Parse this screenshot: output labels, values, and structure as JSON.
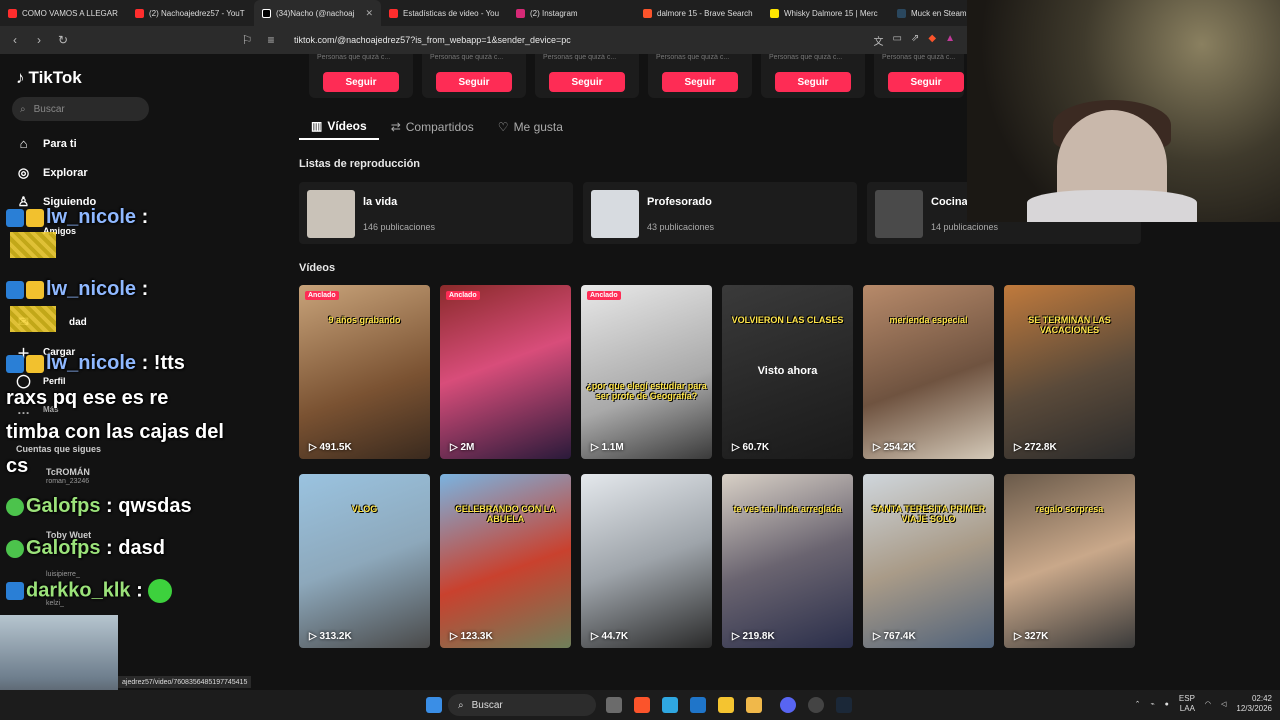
{
  "browser": {
    "tabs": [
      {
        "title": "COMO VAMOS A LLEGAR",
        "color": "#ff2d2d"
      },
      {
        "title": "(2) Nachoajedrez57 - YouT",
        "color": "#ff2d2d"
      },
      {
        "title": "(34)Nacho (@nachoaj",
        "color": "#111111",
        "active": true
      },
      {
        "title": "Estadísticas de video - You",
        "color": "#ff2d2d"
      },
      {
        "title": "(2) Instagram",
        "color": "#d62976"
      },
      {
        "title": "dalmore 15 - Brave Search",
        "color": "#fb542b"
      },
      {
        "title": "Whisky Dalmore 15 | Merc",
        "color": "#ffe600"
      },
      {
        "title": "Muck en Steam",
        "color": "#2a475e"
      }
    ],
    "url": "tiktok.com/@nachoajedrez57?is_from_webapp=1&sender_device=pc",
    "status_url": "ajedrez57/video/7608356485197745415"
  },
  "sidebar": {
    "logo": "TikTok",
    "search_placeholder": "Buscar",
    "items": [
      {
        "label": "Para ti",
        "icon": "home-icon"
      },
      {
        "label": "Explorar",
        "icon": "compass-icon"
      },
      {
        "label": "Siguiendo",
        "icon": "following-icon"
      },
      {
        "label": "Amigos",
        "icon": "friends-icon"
      },
      {
        "label": "dad",
        "icon": "direct-icon"
      },
      {
        "label": "Cargar",
        "icon": "upload-icon"
      },
      {
        "label": "Perfil",
        "icon": "profile-icon"
      },
      {
        "label": "Más",
        "icon": "more-icon"
      }
    ],
    "following_title": "Cuentas que sigues",
    "following": [
      {
        "name": "TcROMÁN",
        "handle": "roman_23246"
      },
      {
        "name": "Toby Wuet",
        "handle": "luisipierre_"
      },
      {
        "name": "kelzi",
        "handle": "kelzi_"
      }
    ]
  },
  "chat": [
    {
      "user": "lw_nicole",
      "text": ":"
    },
    {
      "user": "lw_nicole",
      "text": ":"
    },
    {
      "user": "lw_nicole",
      "text": ": !tts"
    },
    {
      "user": "",
      "text": "raxs pq ese es re"
    },
    {
      "user": "",
      "text": "timba con las cajas del"
    },
    {
      "user": "",
      "text": "cs"
    },
    {
      "user": "Galofps",
      "text": ": qwsdas"
    },
    {
      "user": "Galofps",
      "text": ": dasd"
    },
    {
      "user": "darkko_klk",
      "text": ":"
    }
  ],
  "suggestions": {
    "caption": "Personas que quizá c...",
    "button": "Seguir"
  },
  "profile_tabs": [
    {
      "label": "Vídeos",
      "icon": "grid-icon"
    },
    {
      "label": "Compartidos",
      "icon": "repost-icon"
    },
    {
      "label": "Me gusta",
      "icon": "heart-icon"
    }
  ],
  "playlists_title": "Listas de reproducción",
  "playlists": [
    {
      "name": "la vida",
      "count": "146 publicaciones",
      "color": "#c9c2b8"
    },
    {
      "name": "Profesorado",
      "count": "43 publicaciones",
      "color": "#d7dbe0"
    },
    {
      "name": "Cocina",
      "count": "14 publicaciones",
      "color": "#4a4a4a"
    }
  ],
  "videos_title": "Vídeos",
  "pinned_label": "Anclado",
  "watched_label": "Visto ahora",
  "videos": [
    {
      "views": "491.5K",
      "pinned": true,
      "overlay": "9 años grabando",
      "bg": "linear-gradient(160deg,#c8a37a,#7a5232 60%,#3a2a1e)"
    },
    {
      "views": "2M",
      "pinned": true,
      "overlay": "",
      "bg": "linear-gradient(160deg,#8a2a2a,#d84d7a 45%,#2a1a3a)"
    },
    {
      "views": "1.1M",
      "pinned": true,
      "overlay": "¿por que elegí estudiar para ser profe de Geografía?",
      "bg": "linear-gradient(160deg,#e8e8e8,#a9a9a9 60%,#3a3a3a)"
    },
    {
      "views": "60.7K",
      "pinned": false,
      "overlay": "VOLVIERON LAS CLASES",
      "bg": "linear-gradient(160deg,#3a3a3a,#262626 60%,#1a1a1a)",
      "watched": true
    },
    {
      "views": "254.2K",
      "pinned": false,
      "overlay": "merienda especial",
      "bg": "linear-gradient(160deg,#b78a6a,#6f5340 55%,#d4c9b8)"
    },
    {
      "views": "272.8K",
      "pinned": false,
      "overlay": "SE TERMINAN LAS VACACIONES",
      "bg": "linear-gradient(160deg,#c07a3c,#5a4a3a 55%,#2a2a2a)"
    },
    {
      "views": "313.2K",
      "pinned": false,
      "overlay": "VLOG",
      "bg": "linear-gradient(160deg,#9ac3e0,#8da8bb 50%,#4a4a4a)"
    },
    {
      "views": "123.3K",
      "pinned": false,
      "overlay": "CELEBRANDO CON LA ABUELA",
      "bg": "linear-gradient(160deg,#7ab3e0,#c9412e 55%,#6f7f5a)"
    },
    {
      "views": "44.7K",
      "pinned": false,
      "overlay": "",
      "bg": "linear-gradient(160deg,#e4e8ec,#9ea4aa 50%,#2a2a2a)"
    },
    {
      "views": "219.8K",
      "pinned": false,
      "overlay": "te ves tan linda arreglada",
      "bg": "linear-gradient(160deg,#d8d0c6,#6a6470 50%,#2a2e4a)"
    },
    {
      "views": "767.4K",
      "pinned": false,
      "overlay": "SANTA TERESITA PRIMER VIAJE SOLO",
      "bg": "linear-gradient(160deg,#cfd6dc,#a99b88 50%,#50627a)"
    },
    {
      "views": "327K",
      "pinned": false,
      "overlay": "regalo sorpresa",
      "bg": "linear-gradient(160deg,#6a5a4a,#c9a88a 50%,#3a3a3a)"
    }
  ],
  "taskbar": {
    "search": "Buscar",
    "lang": "ESP",
    "lang2": "LAA",
    "time": "02:42",
    "date": "12/3/2026"
  }
}
